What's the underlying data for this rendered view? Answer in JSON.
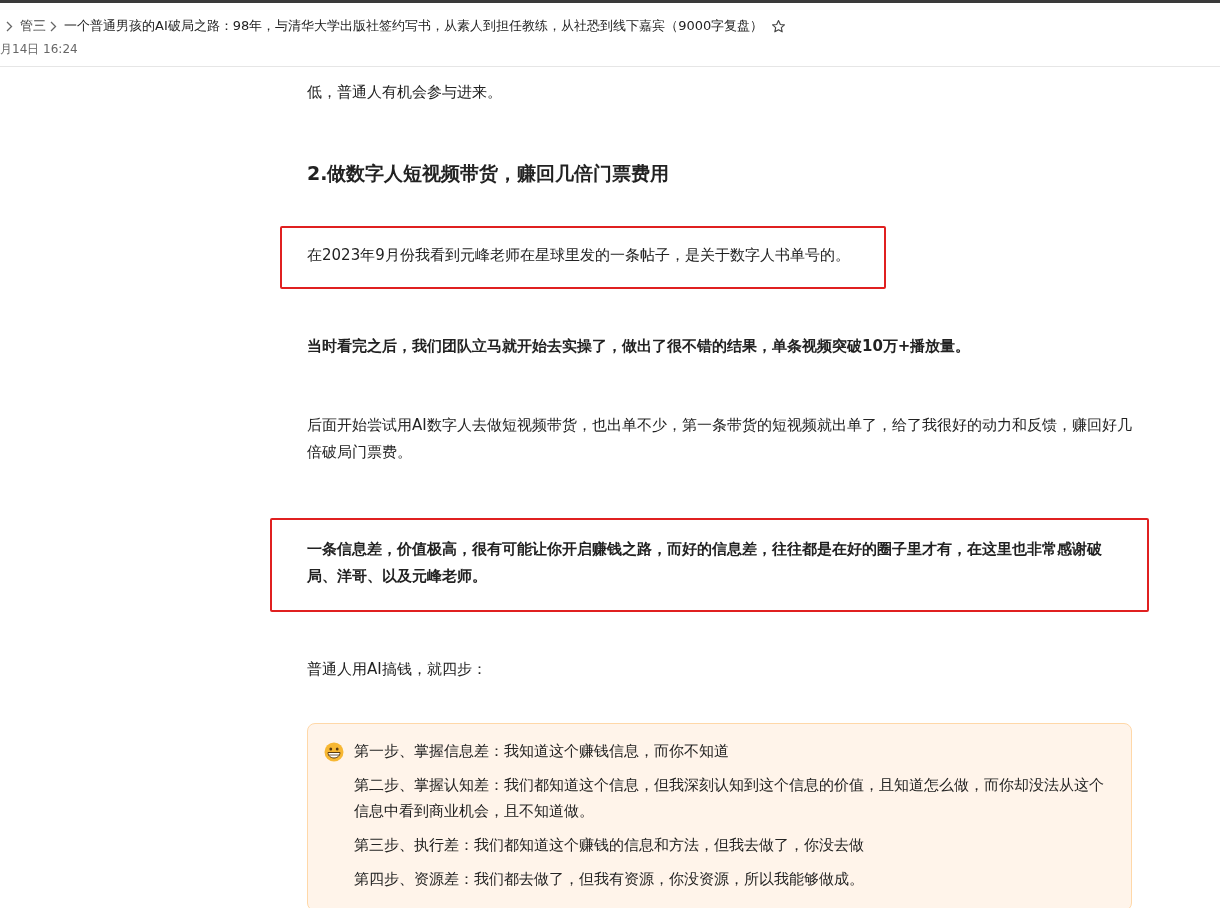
{
  "header": {
    "breadcrumb": [
      "管三",
      "一个普通男孩的AI破局之路：98年，与清华大学出版社签约写书，从素人到担任教练，从社恐到线下嘉宾（9000字复盘）"
    ],
    "starred": false,
    "timestamp": "月14日 16:24"
  },
  "article": [
    {
      "kind": "text",
      "text": "低，普通人有机会参与进来。",
      "highlighted": false
    },
    {
      "kind": "heading",
      "text": "2.做数字人短视频带货，赚回几倍门票费用",
      "highlighted": false
    },
    {
      "kind": "text",
      "text": "在2023年9月份我看到元峰老师在星球里发的一条帖子，是关于数字人书单号的。",
      "highlighted": true
    },
    {
      "kind": "bold",
      "text": "当时看完之后，我们团队立马就开始去实操了，做出了很不错的结果，单条视频突破10万+播放量。",
      "highlighted": false
    },
    {
      "kind": "text",
      "text": "后面开始尝试用AI数字人去做短视频带货，也出单不少，第一条带货的短视频就出单了，给了我很好的动力和反馈，赚回好几倍破局门票费。",
      "highlighted": false
    },
    {
      "kind": "bold",
      "text": "一条信息差，价值极高，很有可能让你开启赚钱之路，而好的信息差，往往都是在好的圈子里才有，在这里也非常感谢破局、洋哥、以及元峰老师。",
      "highlighted": true
    },
    {
      "kind": "text",
      "text": "普通人用AI搞钱，就四步：",
      "highlighted": false
    },
    {
      "kind": "callout",
      "items": [
        "第一步、掌握信息差：我知道这个赚钱信息，而你不知道",
        "第二步、掌握认知差：我们都知道这个信息，但我深刻认知到这个信息的价值，且知道怎么做，而你却没法从这个信息中看到商业机会，且不知道做。",
        "第三步、执行差：我们都知道这个赚钱的信息和方法，但我去做了，你没去做",
        "第四步、资源差：我们都去做了，但我有资源，你没资源，所以我能够做成。"
      ]
    }
  ]
}
